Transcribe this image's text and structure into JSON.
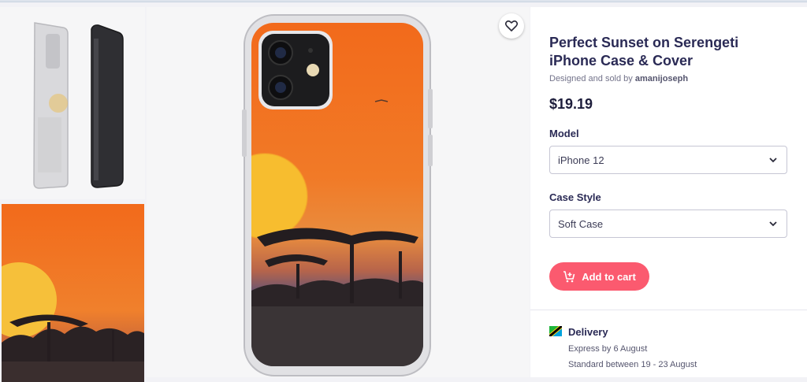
{
  "product": {
    "title": "Perfect Sunset on Serengeti iPhone Case & Cover",
    "designed_prefix": "Designed and sold by",
    "designer": "amanijoseph",
    "price": "$19.19"
  },
  "options": {
    "model_label": "Model",
    "model_value": "iPhone 12",
    "case_label": "Case Style",
    "case_value": "Soft Case"
  },
  "actions": {
    "add_to_cart": "Add to cart",
    "favorite_icon": "heart-icon",
    "cart_icon": "cart-plus-icon"
  },
  "delivery": {
    "title": "Delivery",
    "express": "Express by 6 August",
    "standard": "Standard between 19 - 23 August"
  },
  "colors": {
    "accent": "#fb5a6f",
    "title": "#2a2a55"
  }
}
